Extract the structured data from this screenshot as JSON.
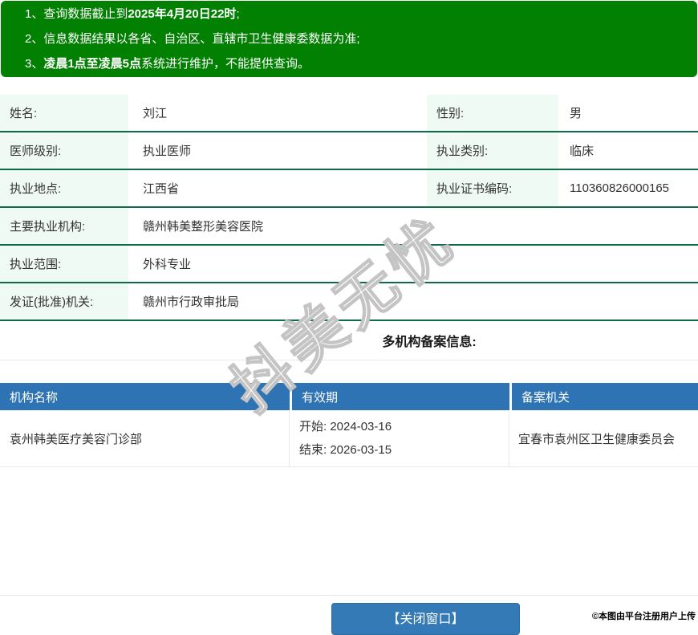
{
  "colors": {
    "notice_green": "#018001",
    "row_border_green": "#0d6b46",
    "label_bg_green": "#f0faf4",
    "table_header_blue": "#2e74b5",
    "button_blue": "#337ab7"
  },
  "notices": {
    "items": [
      {
        "prefix": "1、查询数据截止到",
        "bold": "2025年4月20日22时",
        "suffix": ";"
      },
      {
        "prefix": "2、信息数据结果以各省、自治区、直辖市卫生健康委数据为准;",
        "bold": "",
        "suffix": ""
      },
      {
        "prefix": "3、",
        "bold": "凌晨1点至凌晨5点",
        "suffix": "系统进行维护，不能提供查询。"
      }
    ]
  },
  "profile": {
    "rows": [
      {
        "pairs": [
          {
            "label": "姓名:",
            "value": "刘江"
          },
          {
            "label": "性别:",
            "value": "男"
          }
        ]
      },
      {
        "pairs": [
          {
            "label": "医师级别:",
            "value": "执业医师"
          },
          {
            "label": "执业类别:",
            "value": "临床"
          }
        ]
      },
      {
        "pairs": [
          {
            "label": "执业地点:",
            "value": "江西省"
          },
          {
            "label": "执业证书编码:",
            "value": "110360826000165"
          }
        ]
      },
      {
        "pairs": [
          {
            "label": "主要执业机构:",
            "value": "赣州韩美整形美容医院"
          }
        ]
      },
      {
        "pairs": [
          {
            "label": "执业范围:",
            "value": "外科专业"
          }
        ]
      },
      {
        "pairs": [
          {
            "label": "发证(批准)机关:",
            "value": "赣州市行政审批局"
          }
        ]
      }
    ]
  },
  "filing_section": {
    "heading": "多机构备案信息:",
    "headers": [
      "机构名称",
      "有效期",
      "备案机关"
    ],
    "row": {
      "org_name": "袁州韩美医疗美容门诊部",
      "period": [
        "开始: 2024-03-16",
        "结束: 2026-03-15"
      ],
      "authority": "宜春市袁州区卫生健康委员会"
    }
  },
  "footer": {
    "close_button_label": "【关闭窗口】",
    "copyright": "©本图由平台注册用户上传"
  },
  "watermark_text": "抖美无忧"
}
